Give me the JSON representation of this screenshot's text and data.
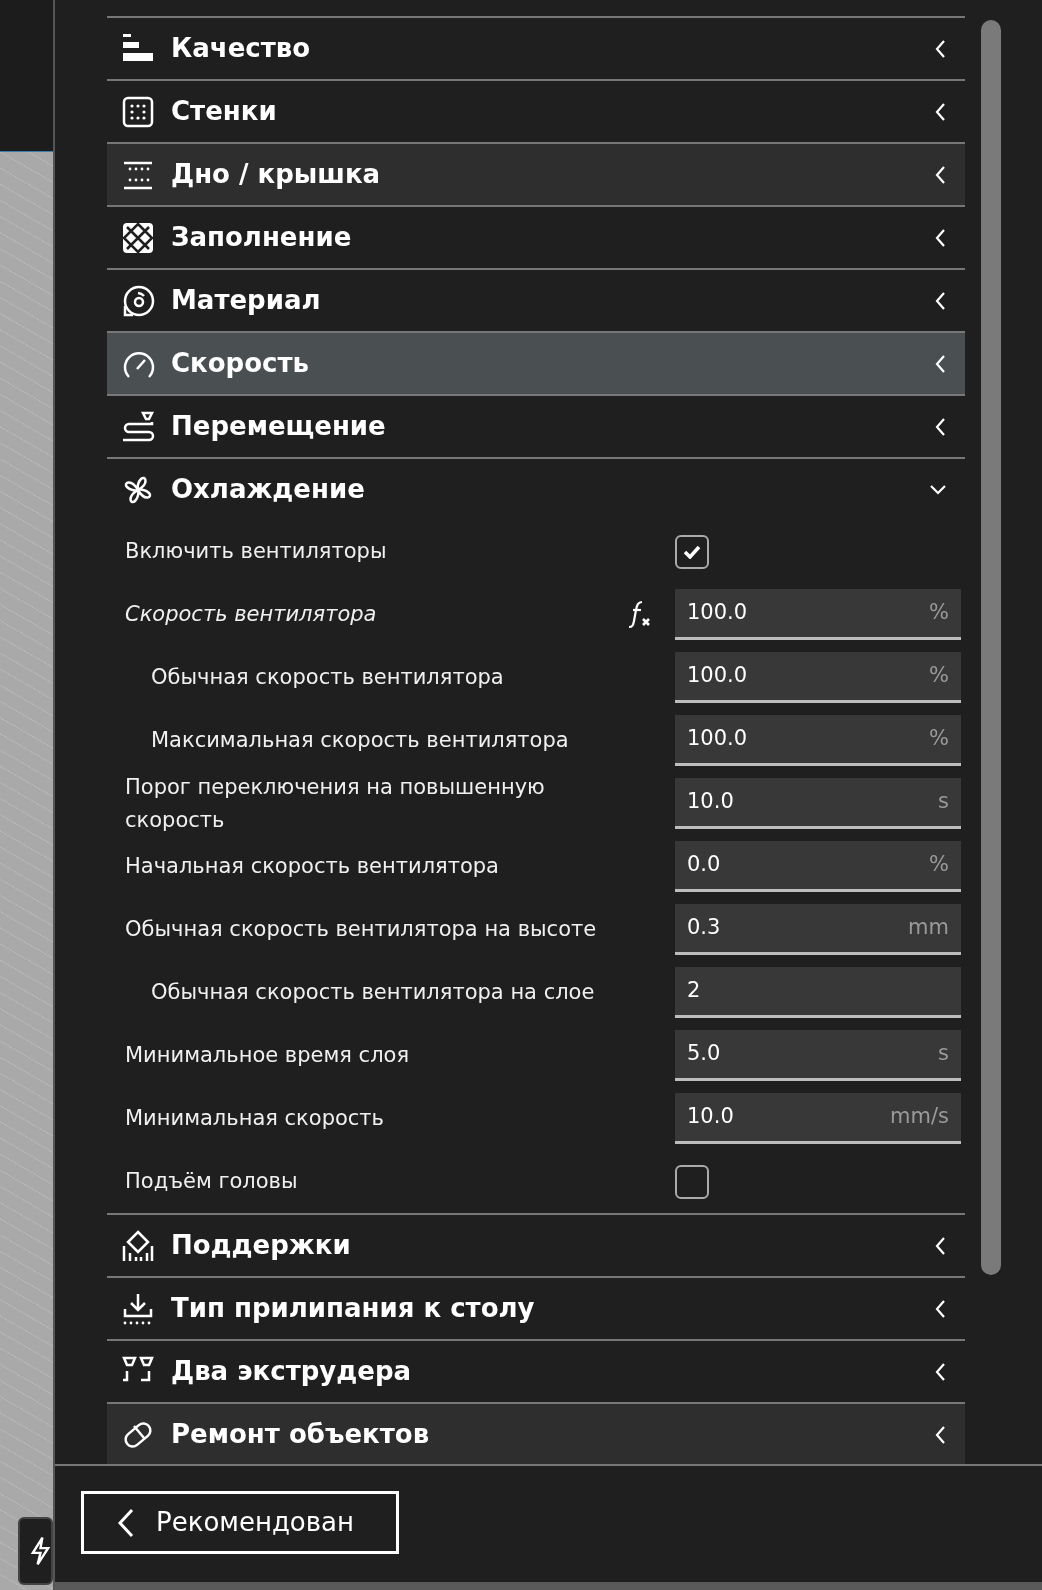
{
  "categories": [
    {
      "title": "Качество",
      "highlighted": false,
      "hovered": false,
      "expanded": false
    },
    {
      "title": "Стенки",
      "highlighted": false,
      "hovered": false,
      "expanded": false
    },
    {
      "title": "Дно / крышка",
      "highlighted": true,
      "hovered": false,
      "expanded": false
    },
    {
      "title": "Заполнение",
      "highlighted": false,
      "hovered": false,
      "expanded": false
    },
    {
      "title": "Материал",
      "highlighted": false,
      "hovered": false,
      "expanded": false
    },
    {
      "title": "Скорость",
      "highlighted": false,
      "hovered": true,
      "expanded": false
    },
    {
      "title": "Перемещение",
      "highlighted": false,
      "hovered": false,
      "expanded": false
    },
    {
      "title": "Охлаждение",
      "highlighted": false,
      "hovered": false,
      "expanded": true,
      "settings": [
        {
          "label": "Включить вентиляторы",
          "kind": "checkbox",
          "checked": true,
          "formula": false
        },
        {
          "label": "Скорость вентилятора",
          "kind": "number",
          "value": "100.0",
          "unit": "%",
          "formula": true,
          "children": [
            {
              "label": "Обычная скорость вентилятора",
              "kind": "number",
              "value": "100.0",
              "unit": "%",
              "formula": false
            },
            {
              "label": "Максимальная скорость вентилятора",
              "kind": "number",
              "value": "100.0",
              "unit": "%",
              "formula": false
            }
          ]
        },
        {
          "label": "Порог переключения на повышенную скорость",
          "kind": "number",
          "value": "10.0",
          "unit": "s",
          "formula": false
        },
        {
          "label": "Начальная скорость вентилятора",
          "kind": "number",
          "value": "0.0",
          "unit": "%",
          "formula": false
        },
        {
          "label": "Обычная скорость вентилятора на высоте",
          "kind": "number",
          "value": "0.3",
          "unit": "mm",
          "formula": false,
          "children": [
            {
              "label": "Обычная скорость вентилятора на слое",
              "kind": "number",
              "value": "2",
              "formula": false
            }
          ]
        },
        {
          "label": "Минимальное время слоя",
          "kind": "number",
          "value": "5.0",
          "unit": "s",
          "formula": false
        },
        {
          "label": "Минимальная скорость",
          "kind": "number",
          "value": "10.0",
          "unit": "mm/s",
          "formula": false
        },
        {
          "label": "Подъём головы",
          "kind": "checkbox",
          "checked": false,
          "formula": false
        }
      ]
    },
    {
      "title": "Поддержки",
      "highlighted": false,
      "hovered": false,
      "expanded": false
    },
    {
      "title": "Тип прилипания к столу",
      "highlighted": false,
      "hovered": false,
      "expanded": false
    },
    {
      "title": "Два экструдера",
      "highlighted": false,
      "hovered": false,
      "expanded": false
    },
    {
      "title": "Ремонт объектов",
      "highlighted": true,
      "hovered": false,
      "expanded": false
    }
  ],
  "mode_button": {
    "label": "Рекомендован"
  }
}
